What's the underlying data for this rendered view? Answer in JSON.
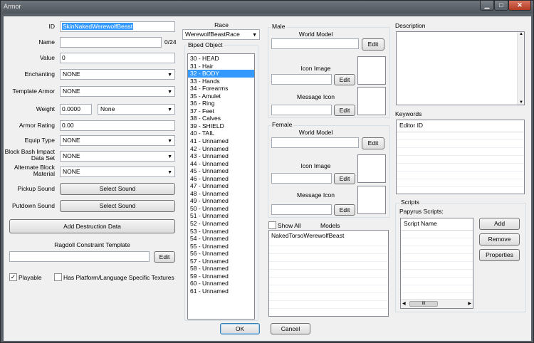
{
  "window": {
    "title": "Armor",
    "min": "▁",
    "max": "□",
    "close": "✕"
  },
  "form": {
    "id_label": "ID",
    "id_value": "SkinNakedWerewolfBeast",
    "name_label": "Name",
    "name_value": "",
    "name_counter": "0/24",
    "value_label": "Value",
    "value_value": "0",
    "enchanting_label": "Enchanting",
    "enchanting_value": "NONE",
    "template_label": "Template Armor",
    "template_value": "NONE",
    "weight_label": "Weight",
    "weight_value": "0.0000",
    "weight_type": "None",
    "armor_rating_label": "Armor Rating",
    "armor_rating_value": "0.00",
    "equip_type_label": "Equip Type",
    "equip_type_value": "NONE",
    "block_bash_label": "Block Bash Impact Data Set",
    "block_bash_value": "NONE",
    "alt_block_label": "Alternate Block Material",
    "alt_block_value": "NONE",
    "pickup_label": "Pickup Sound",
    "pickup_button": "Select Sound",
    "putdown_label": "Putdown Sound",
    "putdown_button": "Select Sound",
    "destruction_button": "Add Destruction Data",
    "ragdoll_label": "Ragdoll Constraint Template",
    "ragdoll_value": "",
    "ragdoll_edit": "Edit",
    "playable_label": "Playable",
    "playable_checked": true,
    "platform_label": "Has Platform/Language Specific Textures",
    "platform_checked": false
  },
  "race": {
    "label": "Race",
    "value": "WerewolfBeastRace"
  },
  "biped": {
    "label": "Biped Object",
    "selected_index": 2,
    "items": [
      "30 - HEAD",
      "31 - Hair",
      "32 - BODY",
      "33 - Hands",
      "34 - Forearms",
      "35 - Amulet",
      "36 - Ring",
      "37 - Feet",
      "38 - Calves",
      "39 - SHIELD",
      "40 - TAIL",
      "41 - Unnamed",
      "42 - Unnamed",
      "43 - Unnamed",
      "44 - Unnamed",
      "45 - Unnamed",
      "46 - Unnamed",
      "47 - Unnamed",
      "48 - Unnamed",
      "49 - Unnamed",
      "50 - Unnamed",
      "51 - Unnamed",
      "52 - Unnamed",
      "53 - Unnamed",
      "54 - Unnamed",
      "55 - Unnamed",
      "56 - Unnamed",
      "57 - Unnamed",
      "58 - Unnamed",
      "59 - Unnamed",
      "60 - Unnamed",
      "61 - Unnamed"
    ]
  },
  "male": {
    "title": "Male",
    "world_model_label": "World Model",
    "world_model_edit": "Edit",
    "icon_image_label": "Icon Image",
    "icon_image_edit": "Edit",
    "message_icon_label": "Message Icon",
    "message_icon_edit": "Edit"
  },
  "female": {
    "title": "Female",
    "world_model_label": "World Model",
    "world_model_edit": "Edit",
    "icon_image_label": "Icon Image",
    "icon_image_edit": "Edit",
    "message_icon_label": "Message Icon",
    "message_icon_edit": "Edit"
  },
  "models": {
    "show_all_label": "Show All",
    "show_all_checked": false,
    "title": "Models",
    "items": [
      "NakedTorsoWerewolfBeast"
    ]
  },
  "description": {
    "label": "Description",
    "value": ""
  },
  "keywords": {
    "label": "Keywords",
    "column": "Editor ID"
  },
  "scripts": {
    "group_title": "Scripts",
    "papyrus_label": "Papyrus Scripts:",
    "column": "Script Name",
    "add": "Add",
    "remove": "Remove",
    "properties": "Properties",
    "scroll_grip": "III"
  },
  "footer": {
    "ok": "OK",
    "cancel": "Cancel"
  }
}
